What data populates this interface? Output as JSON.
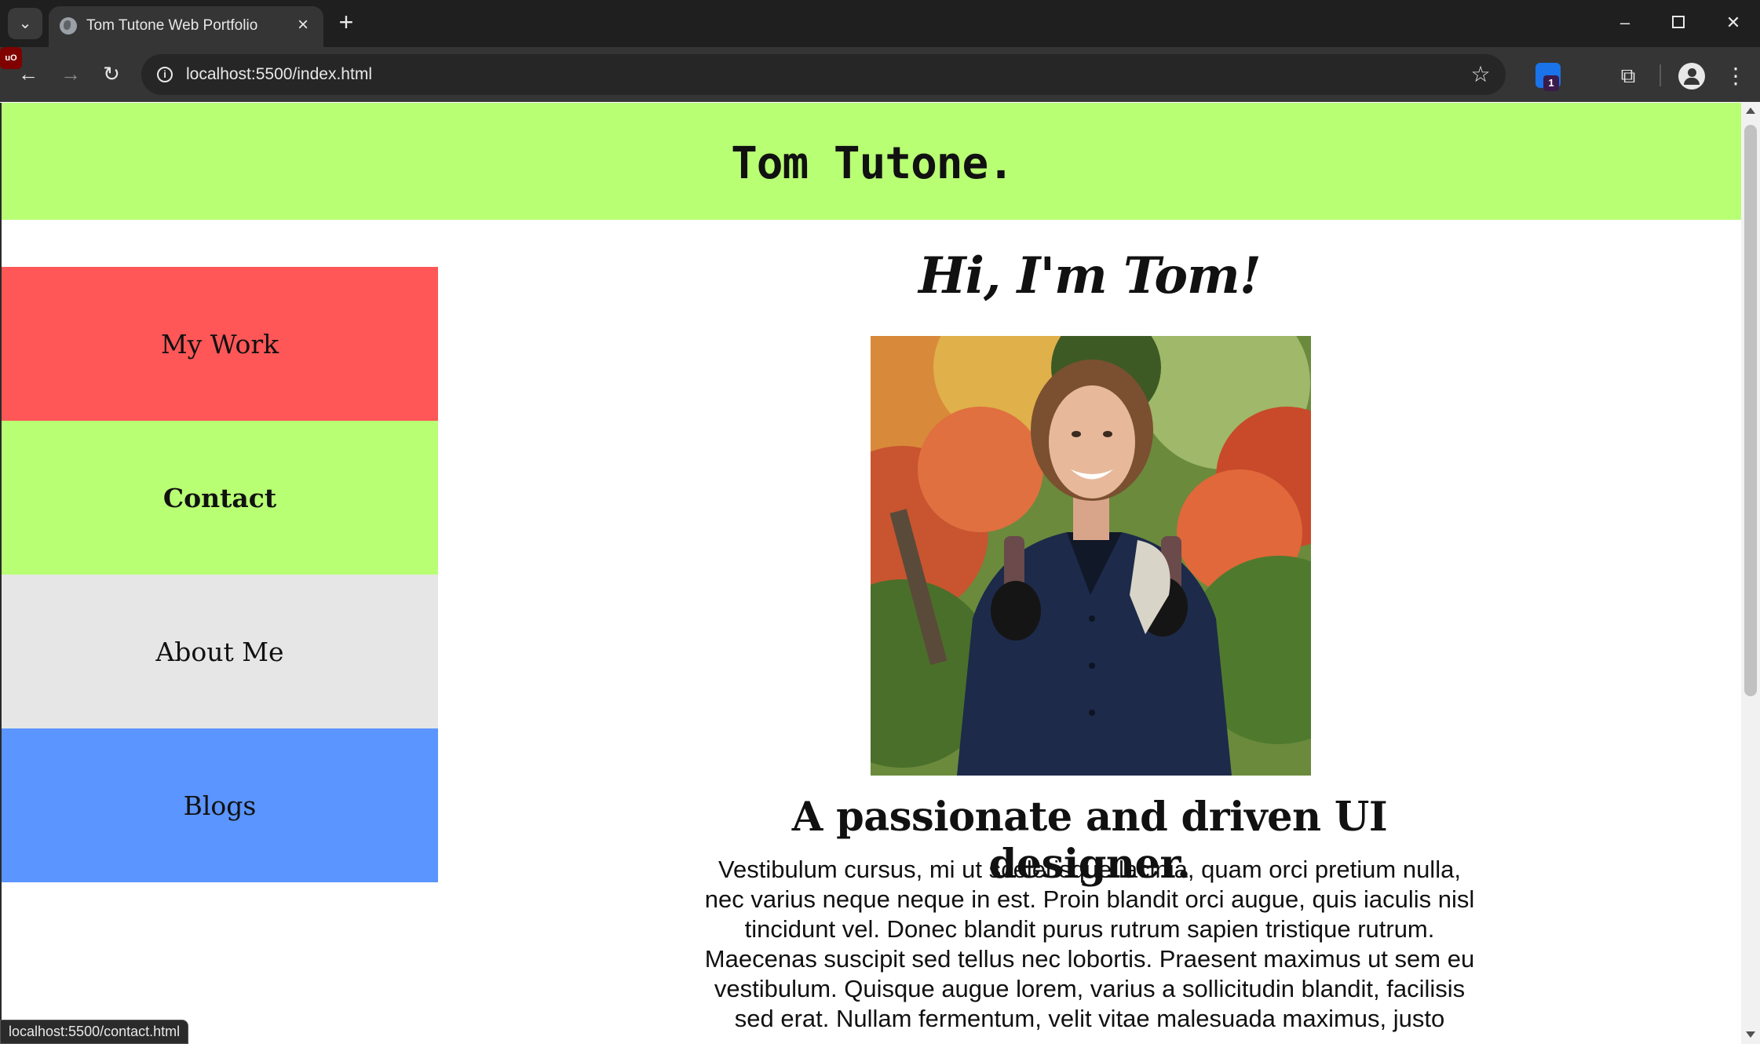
{
  "browser": {
    "tab_title": "Tom Tutone Web Portfolio",
    "tab_favicon": "globe-icon",
    "url": "localhost:5500/index.html",
    "status_url": "localhost:5500/contact.html",
    "extension_badge": "1",
    "extension_2_label": "uO"
  },
  "header": {
    "title": "Tom Tutone.",
    "bg_color": "#b8ff74"
  },
  "nav": {
    "items": [
      {
        "label": "My Work",
        "color": "#ff5757"
      },
      {
        "label": "Contact",
        "color": "#b8ff74"
      },
      {
        "label": "About Me",
        "color": "#e6e6e6"
      },
      {
        "label": "Blogs",
        "color": "#5b95ff"
      }
    ]
  },
  "main": {
    "greeting": "Hi, I'm Tom!",
    "photo": "portrait-photo",
    "tagline": "A passionate and driven UI designer.",
    "intro": "Vestibulum cursus, mi ut scelerisque lacinia, quam orci pretium nulla, nec varius neque neque in est. Proin blandit orci augue, quis iaculis nisl tincidunt vel. Donec blandit purus rutrum sapien tristique rutrum. Maecenas suscipit sed tellus nec lobortis. Praesent maximus ut sem eu vestibulum. Quisque augue lorem, varius a sollicitudin blandit, facilisis sed erat. Nullam fermentum, velit vitae malesuada maximus, justo"
  }
}
